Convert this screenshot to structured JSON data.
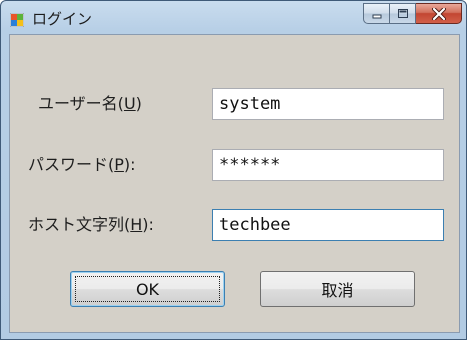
{
  "window": {
    "title": "ログイン",
    "icon": "windows-form-icon",
    "caption_buttons": [
      "minimize-icon",
      "maximize-icon",
      "close-icon"
    ]
  },
  "form": {
    "user": {
      "label_pre": "ユーザー名(",
      "label_key": "U",
      "label_post": ")",
      "value": "system"
    },
    "password": {
      "label_pre": "パスワード(",
      "label_key": "P",
      "label_post": "):",
      "value": "******"
    },
    "host": {
      "label_pre": "ホスト文字列(",
      "label_key": "H",
      "label_post": "):",
      "value": "techbee"
    }
  },
  "buttons": {
    "ok": "OK",
    "cancel": "取消"
  }
}
